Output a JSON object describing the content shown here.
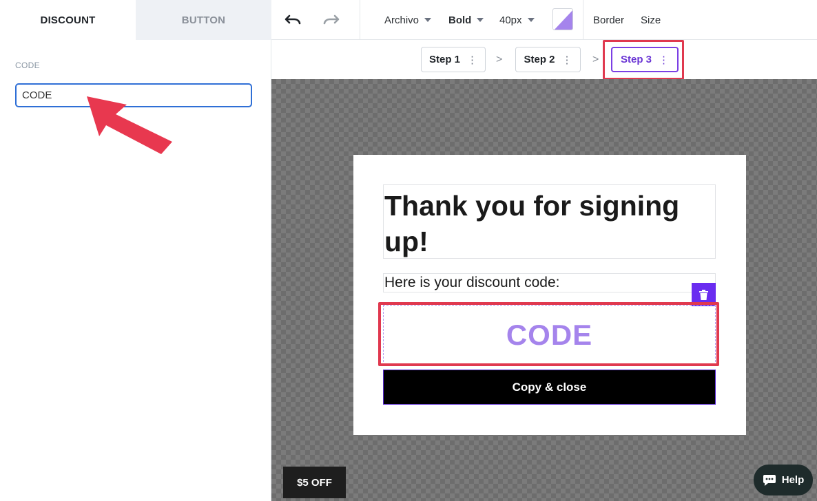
{
  "sidebar": {
    "tabs": [
      {
        "label": "DISCOUNT",
        "active": true
      },
      {
        "label": "BUTTON",
        "active": false
      }
    ],
    "field_label": "CODE",
    "code_value": "CODE"
  },
  "toolbar": {
    "undo_icon": "undo-icon",
    "redo_icon": "redo-icon",
    "font": "Archivo",
    "weight": "Bold",
    "size": "40px",
    "color_swatch": "#a584ec",
    "border_label": "Border",
    "size_label": "Size"
  },
  "steps": [
    {
      "label": "Step 1",
      "active": false
    },
    {
      "label": "Step 2",
      "active": false
    },
    {
      "label": "Step 3",
      "active": true
    }
  ],
  "popup": {
    "headline": "Thank you for signing up!",
    "subtext": "Here is your discount code:",
    "code": "CODE",
    "button": "Copy & close"
  },
  "canvas": {
    "offer_tab": "$5 OFF",
    "help": "Help"
  },
  "colors": {
    "accent": "#6a2cf0",
    "highlight": "#e0394f",
    "code": "#a584ec"
  }
}
